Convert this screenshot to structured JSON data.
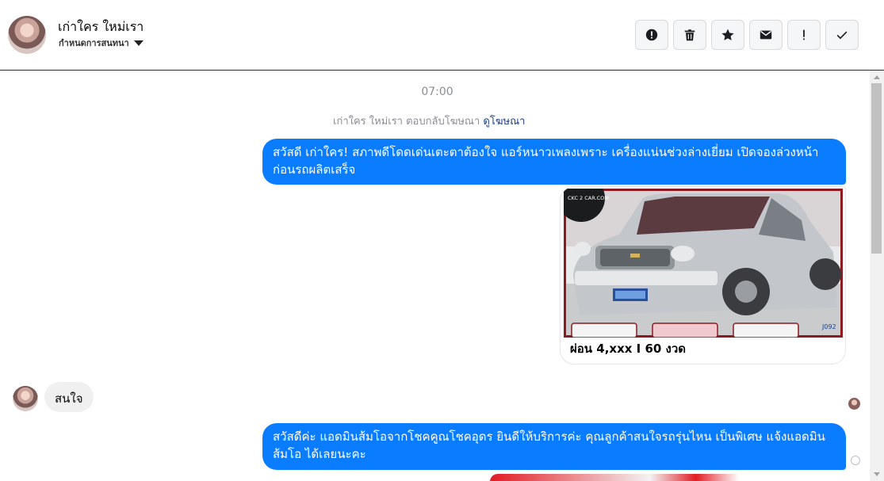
{
  "header": {
    "contact_name": "เก่าใคร ใหม่เรา",
    "set_conversation": "กำหนดการสนทนา",
    "toolbar": [
      {
        "icon": "report-icon"
      },
      {
        "icon": "trash-icon"
      },
      {
        "icon": "star-icon"
      },
      {
        "icon": "envelope-icon"
      },
      {
        "icon": "exclamation-icon",
        "label": "!"
      },
      {
        "icon": "check-icon"
      }
    ]
  },
  "chat": {
    "timestamp": "07:00",
    "ad_reply_prefix": "เก่าใคร ใหม่เรา ตอบกลับโฆษณา",
    "ad_reply_link": "ดูโฆษณา",
    "messages": {
      "m1": "สวัสดี เก่าใคร! สภาพดีโดดเด่นเตะตาต้องใจ แอร์หนาวเพลงเพราะ เครื่องแน่นช่วงล่างเยี่ยม เปิดจองล่วงหน้าก่อนรถผลิตเสร็จ",
      "card_caption": "ผ่อน 4,xxx I 60 งวด",
      "card_logo": "CKC 2 CAR.COM",
      "card_code": "J092",
      "m2": "สนใจ",
      "m3": "สวัสดีค่ะ แอดมินส้มโอจากโชคคูณโชคอุดร ยินดีให้บริการค่ะ   คุณลูกค้าสนใจรถรุ่นไหน เป็นพิเศษ แจ้งแอดมินส้มโอ ได้เลยนะคะ"
    }
  },
  "colors": {
    "outgoing_bubble": "#0a7cff",
    "incoming_bubble": "#f0f0f0",
    "link": "#1c3e8a"
  }
}
